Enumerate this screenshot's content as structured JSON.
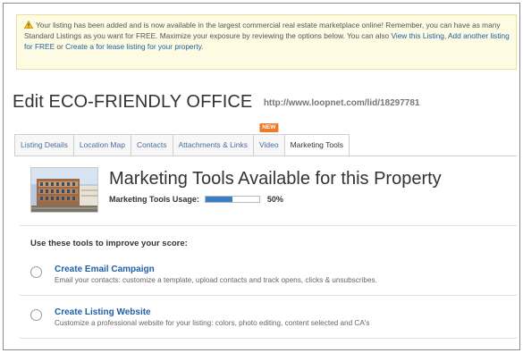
{
  "banner": {
    "message": "Your listing has been added and is now available in the largest commercial real estate marketplace online! Remember, you can have as many Standard Listings as you want for FREE. Maximize your exposure by reviewing the options below. You can also ",
    "link_view": "View this Listing",
    "sep1": ", ",
    "link_add": "Add another listing for FREE",
    "sep2": " or ",
    "link_lease": "Create a for lease listing for your property",
    "end": "."
  },
  "header": {
    "title": "Edit ECO-FRIENDLY OFFICE",
    "url": "http://www.loopnet.com/lid/18297781"
  },
  "tabs": [
    {
      "label": "Listing Details"
    },
    {
      "label": "Location Map"
    },
    {
      "label": "Contacts"
    },
    {
      "label": "Attachments & Links"
    },
    {
      "label": "Video",
      "badge": "NEW"
    },
    {
      "label": "Marketing Tools",
      "active": true
    }
  ],
  "marketing": {
    "title": "Marketing Tools Available for this Property",
    "usage_label": "Marketing Tools Usage:",
    "usage_percent_text": "50%",
    "usage_fraction": 0.5,
    "progress_color": "#3a7fc6"
  },
  "tools": {
    "heading": "Use these tools to improve your score:",
    "items": [
      {
        "title": "Create Email Campaign",
        "description": "Email your contacts: customize a template, upload contacts and track opens, clicks & unsubscribes."
      },
      {
        "title": "Create Listing Website",
        "description": "Customize a professional website for your listing: colors, photo editing, content selected and CA's"
      }
    ]
  }
}
